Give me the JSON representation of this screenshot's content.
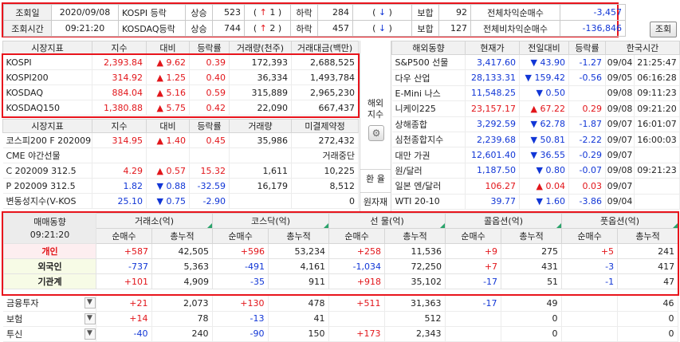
{
  "top": {
    "date_label": "조회일",
    "date_value": "2020/09/08",
    "time_label": "조회시간",
    "time_value": "09:21:20",
    "row1": {
      "market": "KOSPI 등락",
      "up_label": "상승",
      "up_count": "523",
      "up_arrow": "↑",
      "up_limit": "1",
      "down_label": "하락",
      "down_count": "284",
      "down_arrow": "↓",
      "down_limit": "",
      "flat_label": "보합",
      "flat_count": "92",
      "net_label": "전체차익순매수",
      "net_value": "-3,457"
    },
    "row2": {
      "market": "KOSDAQ등락",
      "up_label": "상승",
      "up_count": "744",
      "up_arrow": "↑",
      "up_limit": "2",
      "down_label": "하락",
      "down_count": "457",
      "down_arrow": "↓",
      "down_limit": "",
      "flat_label": "보합",
      "flat_count": "127",
      "net_label": "전체비차익순매수",
      "net_value": "-136,846"
    },
    "lookup_button": "조회"
  },
  "index1": {
    "headers": [
      "시장지표",
      "지수",
      "대비",
      "등락률",
      "거래량(천주)",
      "거래대금(백만)"
    ],
    "rows": [
      {
        "name": "KOSPI",
        "value": "2,393.84",
        "arrow": "▲",
        "change": "9.62",
        "rate": "0.39",
        "volume": "172,393",
        "amount": "2,688,525"
      },
      {
        "name": "KOSPI200",
        "value": "314.92",
        "arrow": "▲",
        "change": "1.25",
        "rate": "0.40",
        "volume": "36,334",
        "amount": "1,493,784"
      },
      {
        "name": "KOSDAQ",
        "value": "884.04",
        "arrow": "▲",
        "change": "5.16",
        "rate": "0.59",
        "volume": "315,889",
        "amount": "2,965,230"
      },
      {
        "name": "KOSDAQ150",
        "value": "1,380.88",
        "arrow": "▲",
        "change": "5.75",
        "rate": "0.42",
        "volume": "22,090",
        "amount": "667,437"
      }
    ]
  },
  "index2": {
    "headers": [
      "시장지표",
      "지수",
      "대비",
      "등락률",
      "거래량",
      "미결제약정"
    ],
    "rows": [
      {
        "name": "코스피200 F 202009",
        "value": "314.95",
        "arrow": "▲",
        "change": "1.40",
        "rate": "0.45",
        "volume": "35,986",
        "oi": "272,432",
        "color": "red"
      },
      {
        "name": "CME 야간선물",
        "value": "",
        "arrow": "",
        "change": "",
        "rate": "",
        "volume": "",
        "oi": "거래중단",
        "color": "black"
      },
      {
        "name": "C 202009 312.5",
        "value": "4.29",
        "arrow": "▲",
        "change": "0.57",
        "rate": "15.32",
        "volume": "1,611",
        "oi": "10,225",
        "color": "red"
      },
      {
        "name": "P 202009 312.5",
        "value": "1.82",
        "arrow": "▼",
        "change": "0.88",
        "rate": "-32.59",
        "volume": "16,179",
        "oi": "8,512",
        "color": "blue"
      },
      {
        "name": "변동성지수(V-KOS",
        "value": "25.10",
        "arrow": "▼",
        "change": "0.75",
        "rate": "-2.90",
        "volume": "",
        "oi": "0",
        "color": "blue"
      }
    ]
  },
  "side": {
    "overseas_label_1": "해외",
    "overseas_label_2": "지수",
    "fx_label": "환 율",
    "raw_label": "원자재",
    "gear_icon": "gear-icon"
  },
  "overseas": {
    "headers": [
      "해외동향",
      "현재가",
      "전일대비",
      "등락률",
      "한국시간"
    ],
    "rows": [
      {
        "name": "S&P500 선물",
        "price": "3,417.60",
        "arrow": "▼",
        "change": "43.90",
        "rate": "-1.27",
        "date": "09/04",
        "time": "21:25:47",
        "color": "blue"
      },
      {
        "name": "다우 산업",
        "price": "28,133.31",
        "arrow": "▼",
        "change": "159.42",
        "rate": "-0.56",
        "date": "09/05",
        "time": "06:16:28",
        "color": "blue"
      },
      {
        "name": "E-Mini 나스",
        "price": "11,548.25",
        "arrow": "▼",
        "change": "0.50",
        "rate": "",
        "date": "09/08",
        "time": "09:11:23",
        "color": "blue"
      },
      {
        "name": "니케이225",
        "price": "23,157.17",
        "arrow": "▲",
        "change": "67.22",
        "rate": "0.29",
        "date": "09/08",
        "time": "09:21:20",
        "color": "red"
      },
      {
        "name": "상해종합",
        "price": "3,292.59",
        "arrow": "▼",
        "change": "62.78",
        "rate": "-1.87",
        "date": "09/07",
        "time": "16:01:07",
        "color": "blue"
      },
      {
        "name": "심천종합지수",
        "price": "2,239.68",
        "arrow": "▼",
        "change": "50.81",
        "rate": "-2.22",
        "date": "09/07",
        "time": "16:00:03",
        "color": "blue"
      },
      {
        "name": "대만 가권",
        "price": "12,601.40",
        "arrow": "▼",
        "change": "36.55",
        "rate": "-0.29",
        "date": "09/07",
        "time": "",
        "color": "blue"
      },
      {
        "name": "원/달러",
        "price": "1,187.50",
        "arrow": "▼",
        "change": "0.80",
        "rate": "-0.07",
        "date": "09/08",
        "time": "09:21:23",
        "color": "blue"
      },
      {
        "name": "일본 엔/달러",
        "price": "106.27",
        "arrow": "▲",
        "change": "0.04",
        "rate": "0.03",
        "date": "09/07",
        "time": "",
        "color": "red"
      },
      {
        "name": "WTI 20-10",
        "price": "39.77",
        "arrow": "▼",
        "change": "1.60",
        "rate": "-3.86",
        "date": "09/04",
        "time": "",
        "color": "blue"
      }
    ]
  },
  "investor": {
    "title": "매매동향",
    "time": "09:21:20",
    "groups": [
      "거래소(억)",
      "코스닥(억)",
      "선 물(억)",
      "콜옵션(억)",
      "풋옵션(억)"
    ],
    "sub_headers": [
      "순매수",
      "총누적"
    ],
    "rows": [
      {
        "name": "개인",
        "values": [
          "+587",
          "42,505",
          "+596",
          "53,234",
          "+258",
          "11,536",
          "+9",
          "275",
          "+5",
          "241"
        ],
        "colors": [
          "red",
          "black",
          "red",
          "black",
          "red",
          "black",
          "red",
          "black",
          "red",
          "black"
        ]
      },
      {
        "name": "외국인",
        "values": [
          "-737",
          "5,363",
          "-491",
          "4,161",
          "-1,034",
          "72,250",
          "+7",
          "431",
          "-3",
          "417"
        ],
        "colors": [
          "blue",
          "black",
          "blue",
          "black",
          "blue",
          "black",
          "red",
          "black",
          "blue",
          "black"
        ]
      },
      {
        "name": "기관계",
        "values": [
          "+101",
          "4,909",
          "-35",
          "911",
          "+918",
          "35,102",
          "-17",
          "51",
          "-1",
          "47"
        ],
        "colors": [
          "red",
          "black",
          "blue",
          "black",
          "red",
          "black",
          "blue",
          "black",
          "blue",
          "black"
        ]
      }
    ],
    "extra_rows": [
      {
        "name": "금융투자",
        "values": [
          "+21",
          "2,073",
          "+130",
          "478",
          "+511",
          "31,363",
          "-17",
          "49",
          "",
          "46"
        ],
        "colors": [
          "red",
          "black",
          "red",
          "black",
          "red",
          "black",
          "blue",
          "black",
          "black",
          "black"
        ]
      },
      {
        "name": "보험",
        "values": [
          "+14",
          "78",
          "-13",
          "41",
          "",
          "512",
          "",
          "0",
          "",
          "0"
        ],
        "colors": [
          "red",
          "black",
          "blue",
          "black",
          "black",
          "black",
          "black",
          "black",
          "black",
          "black"
        ]
      },
      {
        "name": "투신",
        "values": [
          "-40",
          "240",
          "-90",
          "150",
          "+173",
          "2,343",
          "",
          "0",
          "",
          "0"
        ],
        "colors": [
          "blue",
          "black",
          "blue",
          "black",
          "red",
          "black",
          "black",
          "black",
          "black",
          "black"
        ]
      }
    ]
  },
  "colors": {
    "up": "#e2151a",
    "down": "#1136d6",
    "highlight_border": "#e8141c"
  }
}
